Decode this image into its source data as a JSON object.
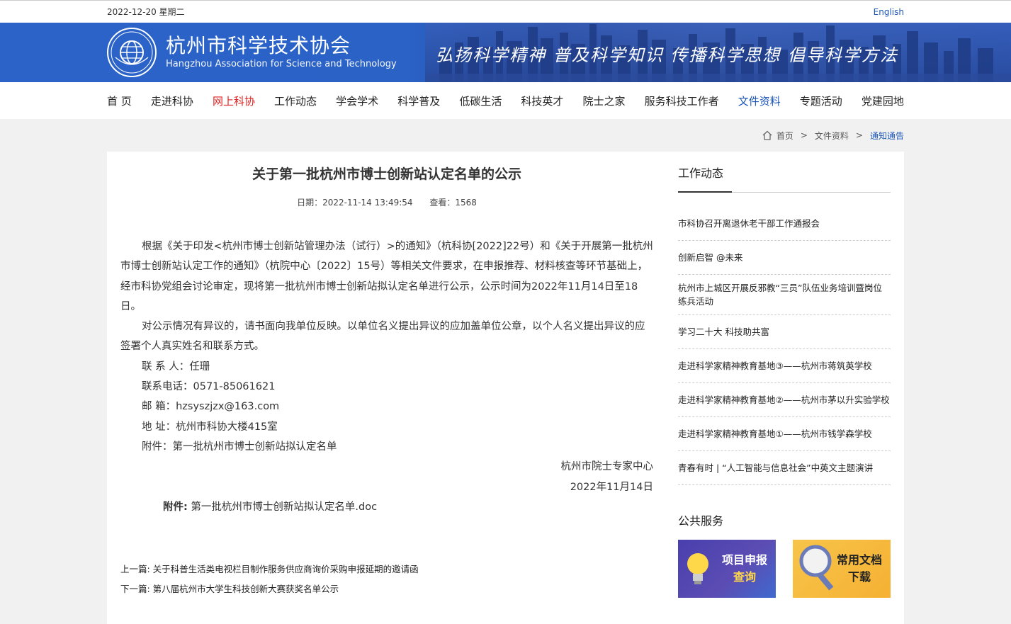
{
  "topbar": {
    "date": "2022-12-20 星期二",
    "lang": "English"
  },
  "header": {
    "name_cn": "杭州市科学技术协会",
    "name_en": "Hangzhou Association for Science and Technology",
    "slogan": "弘扬科学精神  普及科学知识  传播科学思想  倡导科学方法"
  },
  "nav": [
    "首 页",
    "走进科协",
    "网上科协",
    "工作动态",
    "学会学术",
    "科学普及",
    "低碳生活",
    "科技英才",
    "院士之家",
    "服务科技工作者",
    "文件资料",
    "专题活动",
    "党建园地"
  ],
  "breadcrumb": {
    "home": "首页",
    "sep": ">",
    "section": "文件资料",
    "current": "通知通告"
  },
  "article": {
    "title": "关于第一批杭州市博士创新站认定名单的公示",
    "date": "日期：2022-11-14 13:49:54",
    "views": "查看：1568",
    "para1": "根据《关于印发<杭州市博士创新站管理办法（试行）>的通知》（杭科协[2022]22号）和《关于开展第一批杭州市博士创新站认定工作的通知》（杭院中心〔2022〕15号）等相关文件要求，在申报推荐、材料核查等环节基础上，经市科协党组会讨论审定，现将第一批杭州市博士创新站拟认定名单进行公示，公示时间为2022年11月14日至18日。",
    "para2": "对公示情况有异议的，请书面向我单位反映。以单位名义提出异议的应加盖单位公章，以个人名义提出异议的应签署个人真实姓名和联系方式。",
    "contact": "联 系 人：任珊",
    "phone": "联系电话：0571-85061621",
    "email": "邮 箱：hzsyszjzx@163.com",
    "address": "地 址：杭州市科协大楼415室",
    "attachment_line": "附件：第一批杭州市博士创新站拟认定名单",
    "signer": "杭州市院士专家中心",
    "sign_date": "2022年11月14日",
    "attach_label": "附件:",
    "attach_file": "第一批杭州市博士创新站拟认定名单.doc",
    "prev": "上一篇: 关于科普生活类电视栏目制作服务供应商询价采购申报延期的邀请函",
    "next": "下一篇: 第八届杭州市大学生科技创新大赛获奖名单公示"
  },
  "sidebar": {
    "news_title": "工作动态",
    "news": [
      "市科协召开离退休老干部工作通报会",
      "创新启智 @未来",
      "杭州市上城区开展反邪教“三员”队伍业务培训暨岗位练兵活动",
      "学习二十大 科技助共富",
      "走进科学家精神教育基地③——杭州市蒋筑英学校",
      "走进科学家精神教育基地②——杭州市茅以升实验学校",
      "走进科学家精神教育基地①——杭州市钱学森学校",
      "青春有时 | “人工智能与信息社会”中英文主题演讲"
    ],
    "services_title": "公共服务",
    "service1": [
      "项目申报",
      "查询"
    ],
    "service2": [
      "常用文档",
      "下载"
    ]
  }
}
